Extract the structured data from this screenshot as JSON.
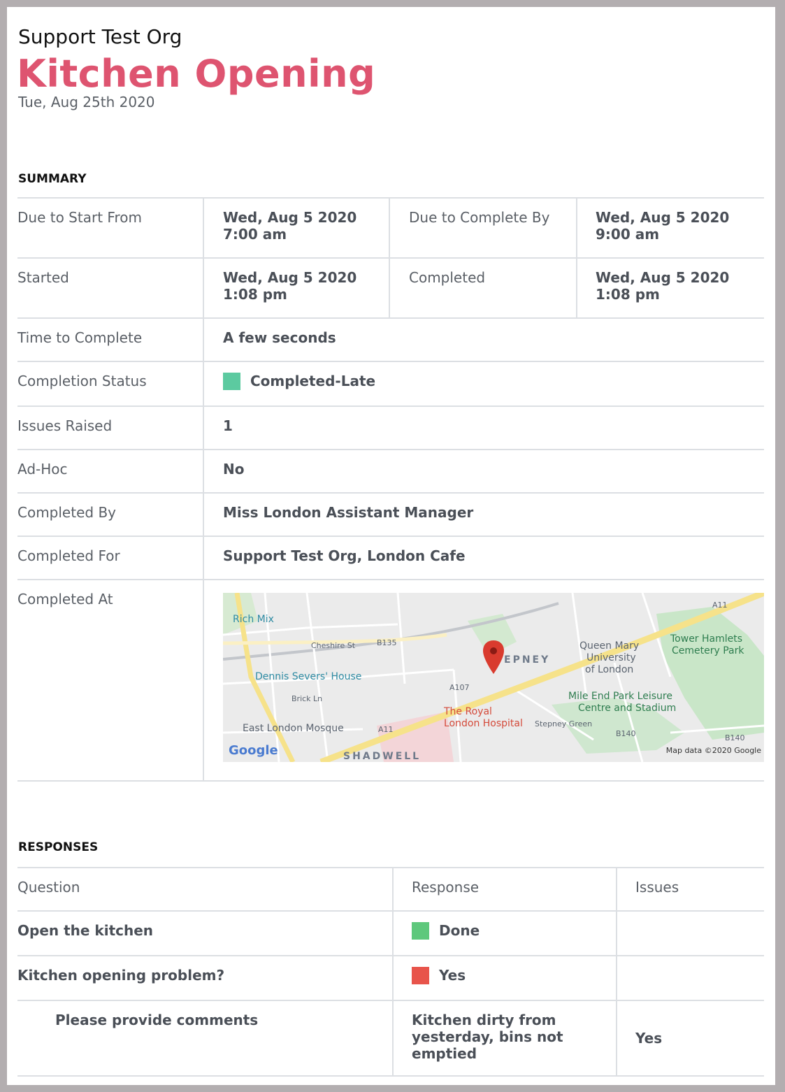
{
  "header": {
    "org_name": "Support Test Org",
    "title": "Kitchen Opening",
    "date": "Tue, Aug 25th 2020"
  },
  "summary": {
    "heading": "SUMMARY",
    "due_start_label": "Due to Start From",
    "due_start_date": "Wed, Aug 5 2020",
    "due_start_time": "7:00 am",
    "due_complete_label": "Due to Complete By",
    "due_complete_date": "Wed, Aug 5 2020",
    "due_complete_time": "9:00 am",
    "started_label": "Started",
    "started_date": "Wed, Aug 5 2020",
    "started_time": "1:08 pm",
    "completed_label": "Completed",
    "completed_date": "Wed, Aug 5 2020",
    "completed_time": "1:08 pm",
    "time_to_complete_label": "Time to Complete",
    "time_to_complete": "A few seconds",
    "status_label": "Completion Status",
    "status": "Completed-Late",
    "status_color": "#5ccaa0",
    "issues_label": "Issues Raised",
    "issues": "1",
    "adhoc_label": "Ad-Hoc",
    "adhoc": "No",
    "completed_by_label": "Completed By",
    "completed_by": "Miss London Assistant Manager",
    "completed_for_label": "Completed For",
    "completed_for": "Support Test Org, London Cafe",
    "completed_at_label": "Completed At"
  },
  "map": {
    "labels": {
      "rich_mix": "Rich Mix",
      "cheshire_st": "Cheshire St",
      "b135": "B135",
      "stepney": "EPNEY",
      "queen_mary": "Queen Mary",
      "university": "University",
      "of_london": "of London",
      "tower_hamlets": "Tower Hamlets",
      "cemetery_park": "Cemetery Park",
      "a11_top": "A11",
      "dennis": "Dennis Severs' House",
      "brick_ln": "Brick Ln",
      "a107": "A107",
      "mile_end": "Mile End Park Leisure",
      "centre": "Centre and Stadium",
      "royal": "The Royal",
      "hospital": "London Hospital",
      "stepney_green": "Stepney Green",
      "mosque": "East London Mosque",
      "a11_bottom": "A11",
      "b140_a": "B140",
      "b140_b": "B140",
      "shadwell": "SHADWELL",
      "google": "Google",
      "copyright": "Map data ©2020 Google"
    }
  },
  "responses": {
    "heading": "RESPONSES",
    "col_question": "Question",
    "col_response": "Response",
    "col_issues": "Issues",
    "rows": [
      {
        "question": "Open the kitchen",
        "response": "Done",
        "color": "#5ec87c",
        "issues": ""
      },
      {
        "question": "Kitchen opening problem?",
        "response": "Yes",
        "color": "#e8544b",
        "issues": ""
      },
      {
        "question": "Please provide comments",
        "response": "Kitchen dirty from yesterday, bins not emptied",
        "issues": "Yes"
      }
    ]
  }
}
